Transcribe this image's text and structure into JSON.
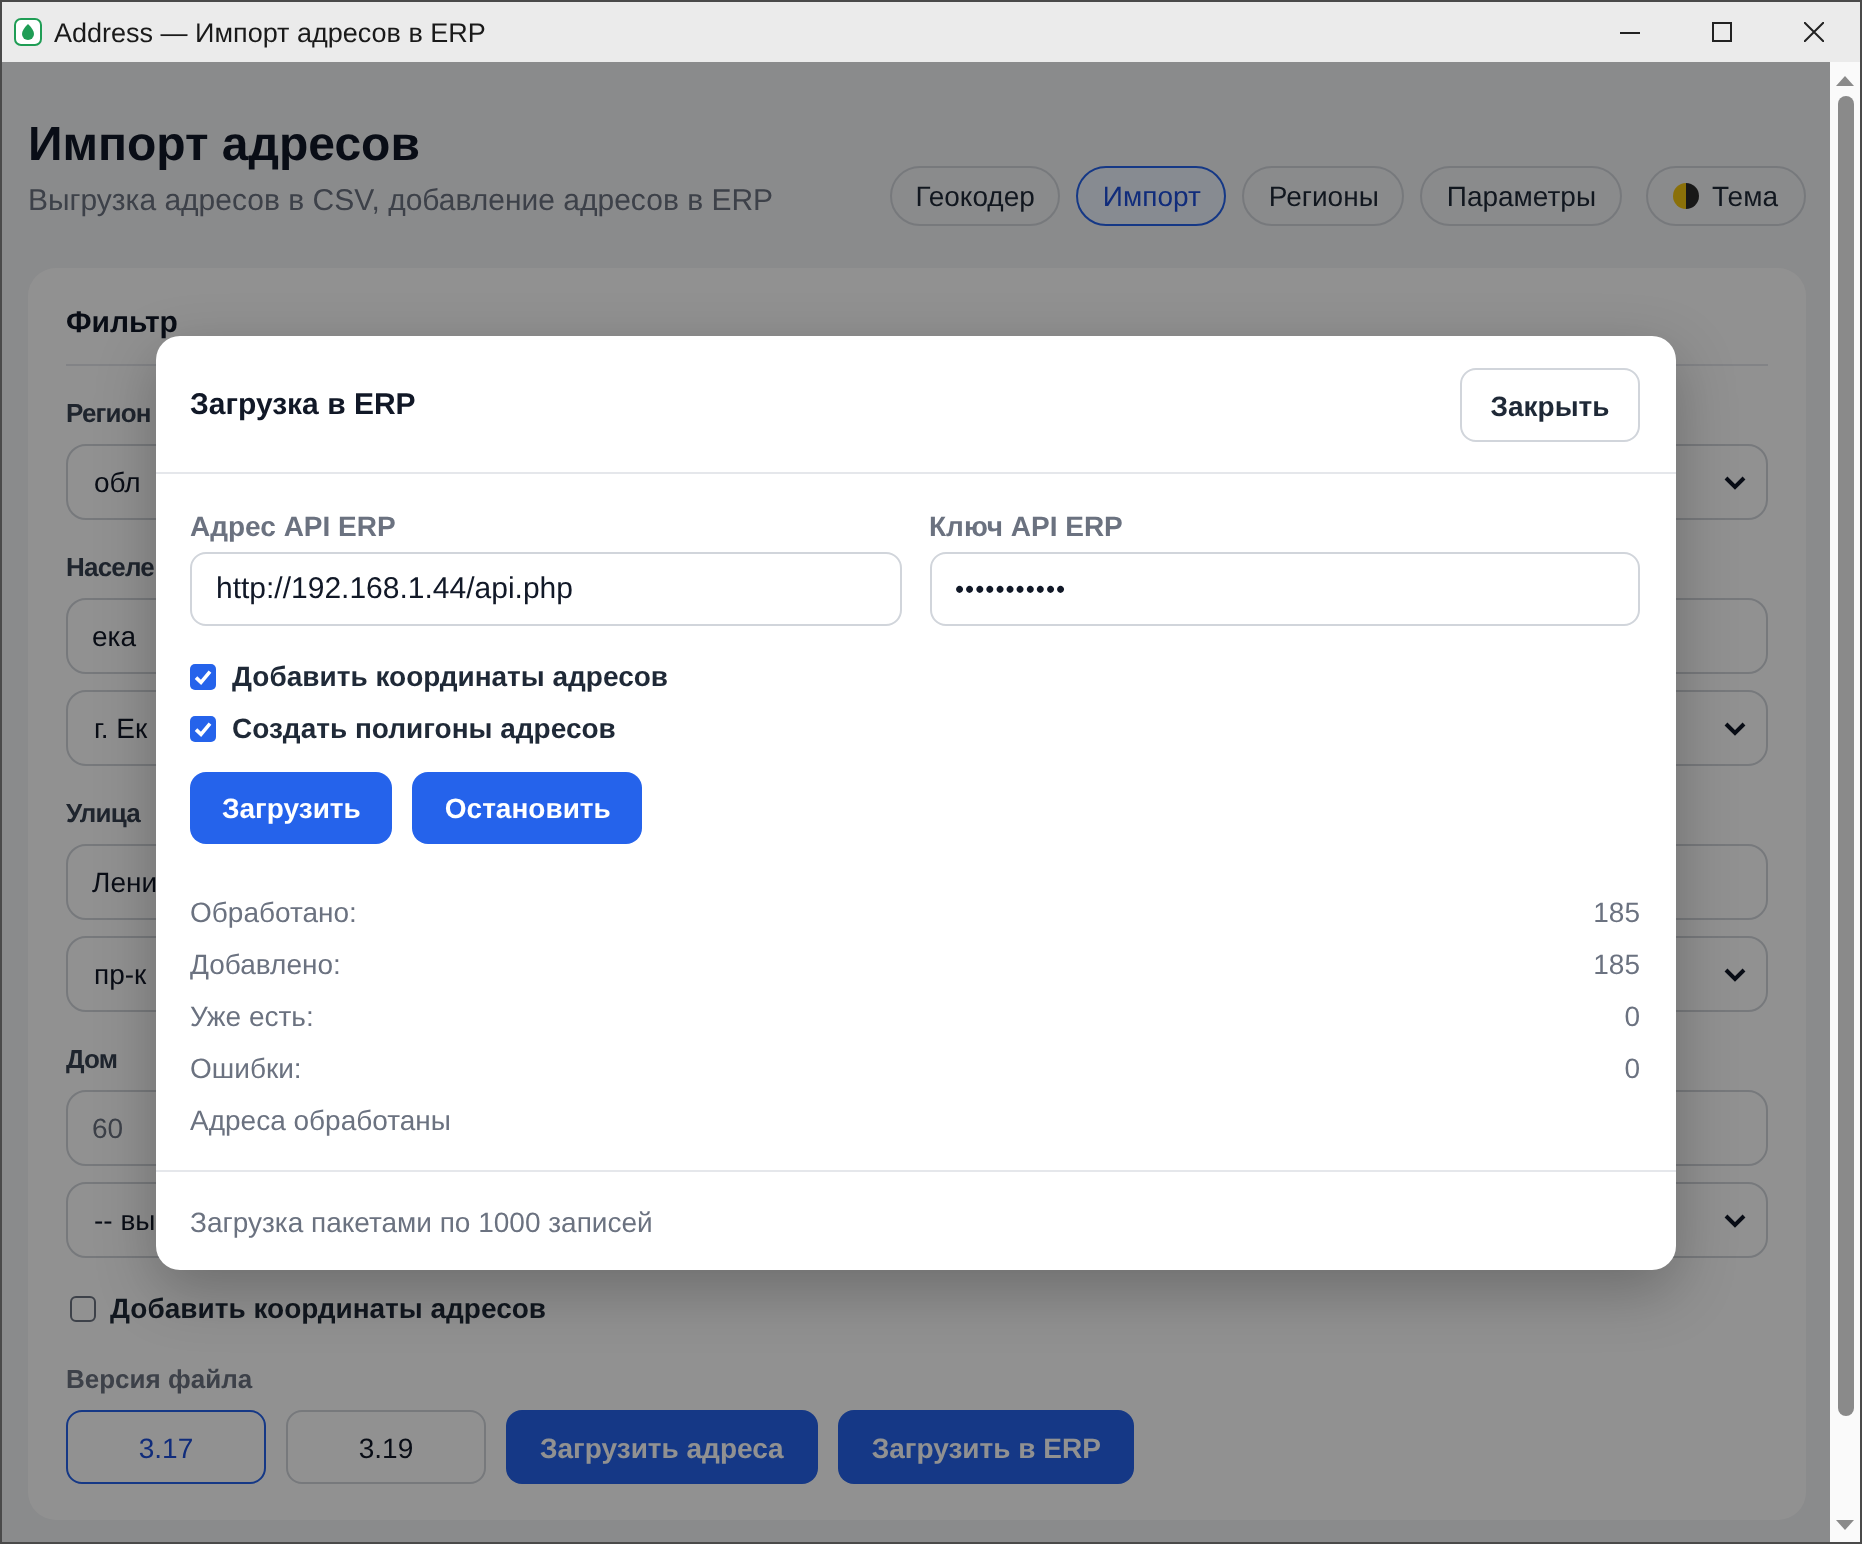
{
  "window": {
    "title": "Address — Импорт адресов в ERP"
  },
  "header": {
    "title": "Импорт адресов",
    "subtitle": "Выгрузка адресов в CSV, добавление адресов в ERP"
  },
  "nav": [
    {
      "label": "Геокодер",
      "selected": false
    },
    {
      "label": "Импорт",
      "selected": true
    },
    {
      "label": "Регионы",
      "selected": false
    },
    {
      "label": "Параметры",
      "selected": false
    }
  ],
  "theme_button": {
    "label": "Тема"
  },
  "filter": {
    "title": "Фильтр",
    "groups": [
      {
        "label": "Регион",
        "controls": [
          {
            "kind": "select",
            "value": "обл"
          }
        ]
      },
      {
        "label": "Населе",
        "controls": [
          {
            "kind": "input",
            "value": "ека"
          },
          {
            "kind": "select",
            "value": "г. Ек"
          }
        ]
      },
      {
        "label": "Улица",
        "controls": [
          {
            "kind": "input",
            "value": "Лени"
          },
          {
            "kind": "select",
            "value": "пр-к"
          }
        ]
      },
      {
        "label": "Дом",
        "controls": [
          {
            "kind": "input",
            "placeholder": "60"
          },
          {
            "kind": "select",
            "value": "-- вы"
          }
        ]
      }
    ],
    "option": {
      "label": "Добавить координаты адресов",
      "checked": false
    },
    "file_version": {
      "label": "Версия файла",
      "options": [
        {
          "label": "3.17",
          "selected": true
        },
        {
          "label": "3.19",
          "selected": false
        }
      ]
    },
    "actions": [
      "Загрузить адреса",
      "Загрузить в ERP"
    ]
  },
  "modal": {
    "title": "Загрузка в ERP",
    "close": "Закрыть",
    "fields": [
      {
        "label": "Адрес API ERP",
        "value": "http://192.168.1.44/api.php",
        "kind": "text"
      },
      {
        "label": "Ключ API ERP",
        "value": "•••••••••••",
        "kind": "password"
      }
    ],
    "options": [
      {
        "label": "Добавить координаты адресов",
        "checked": true
      },
      {
        "label": "Создать полигоны адресов",
        "checked": true
      }
    ],
    "buttons": [
      "Загрузить",
      "Остановить"
    ],
    "stats": [
      {
        "label": "Обработано:",
        "value": "185"
      },
      {
        "label": "Добавлено:",
        "value": "185"
      },
      {
        "label": "Уже есть:",
        "value": "0"
      },
      {
        "label": "Ошибки:",
        "value": "0"
      }
    ],
    "status": "Адреса обработаны",
    "footer": "Загрузка пакетами по 1000 записей"
  }
}
